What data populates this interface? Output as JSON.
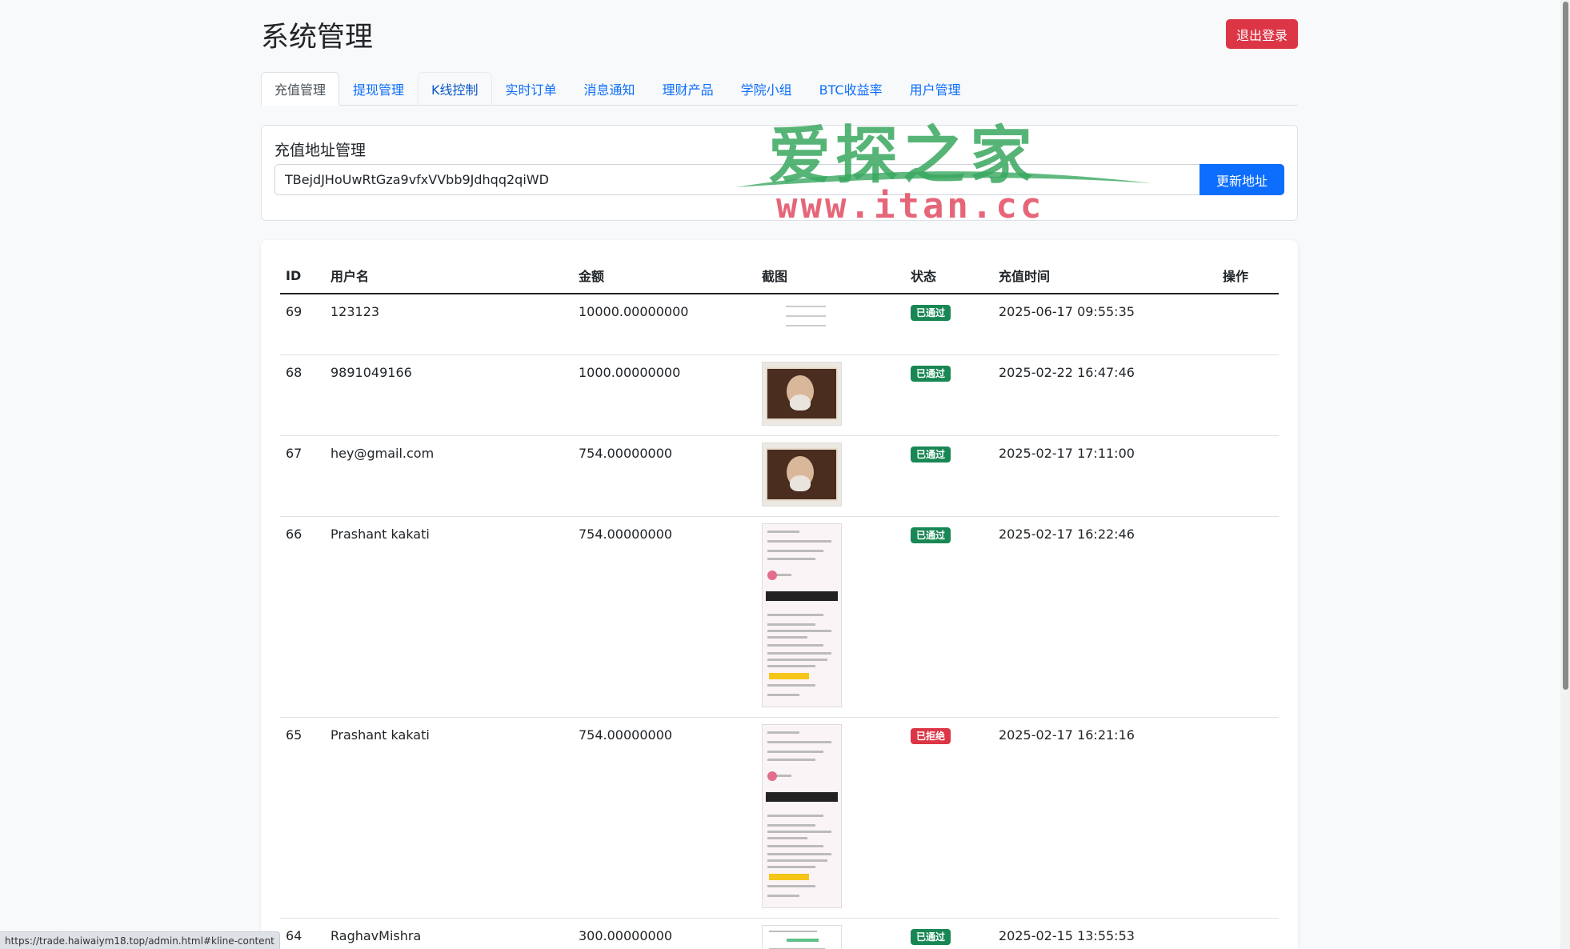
{
  "header": {
    "title": "系统管理",
    "logout_label": "退出登录"
  },
  "tabs": [
    {
      "label": "充值管理",
      "state": "active"
    },
    {
      "label": "提现管理",
      "state": "normal"
    },
    {
      "label": "K线控制",
      "state": "hover"
    },
    {
      "label": "实时订单",
      "state": "normal"
    },
    {
      "label": "消息通知",
      "state": "normal"
    },
    {
      "label": "理财产品",
      "state": "normal"
    },
    {
      "label": "学院小组",
      "state": "normal"
    },
    {
      "label": "BTC收益率",
      "state": "normal"
    },
    {
      "label": "用户管理",
      "state": "normal"
    }
  ],
  "address": {
    "title": "充值地址管理",
    "value": "TBejdJHoUwRtGza9vfxVVbb9Jdhqq2qiWD",
    "update_label": "更新地址"
  },
  "table": {
    "headers": [
      "ID",
      "用户名",
      "金额",
      "截图",
      "状态",
      "充值时间",
      "操作"
    ],
    "rows": [
      {
        "id": "69",
        "user": "123123",
        "amount": "10000.00000000",
        "shot": "small",
        "status": "已通过",
        "status_kind": "ok",
        "time": "2025-06-17 09:55:35"
      },
      {
        "id": "68",
        "user": "9891049166",
        "amount": "1000.00000000",
        "shot": "photo",
        "status": "已通过",
        "status_kind": "ok",
        "time": "2025-02-22 16:47:46"
      },
      {
        "id": "67",
        "user": "hey@gmail.com",
        "amount": "754.00000000",
        "shot": "photo",
        "status": "已通过",
        "status_kind": "ok",
        "time": "2025-02-17 17:11:00"
      },
      {
        "id": "66",
        "user": "Prashant kakati",
        "amount": "754.00000000",
        "shot": "phone",
        "status": "已通过",
        "status_kind": "ok",
        "time": "2025-02-17 16:22:46"
      },
      {
        "id": "65",
        "user": "Prashant kakati",
        "amount": "754.00000000",
        "shot": "phone",
        "status": "已拒绝",
        "status_kind": "no",
        "time": "2025-02-17 16:21:16"
      },
      {
        "id": "64",
        "user": "RaghavMishra",
        "amount": "300.00000000",
        "shot": "receipt",
        "status": "已通过",
        "status_kind": "ok",
        "time": "2025-02-15 13:55:53"
      }
    ]
  },
  "watermark": {
    "top": "爱探之家",
    "bottom": "www.itan.cc"
  },
  "status_bar": {
    "url": "https://trade.haiwaiym18.top/admin.html#kline-content"
  },
  "colors": {
    "primary": "#0d6efd",
    "danger": "#dc3545",
    "success": "#198754",
    "background": "#f8f9fa"
  }
}
